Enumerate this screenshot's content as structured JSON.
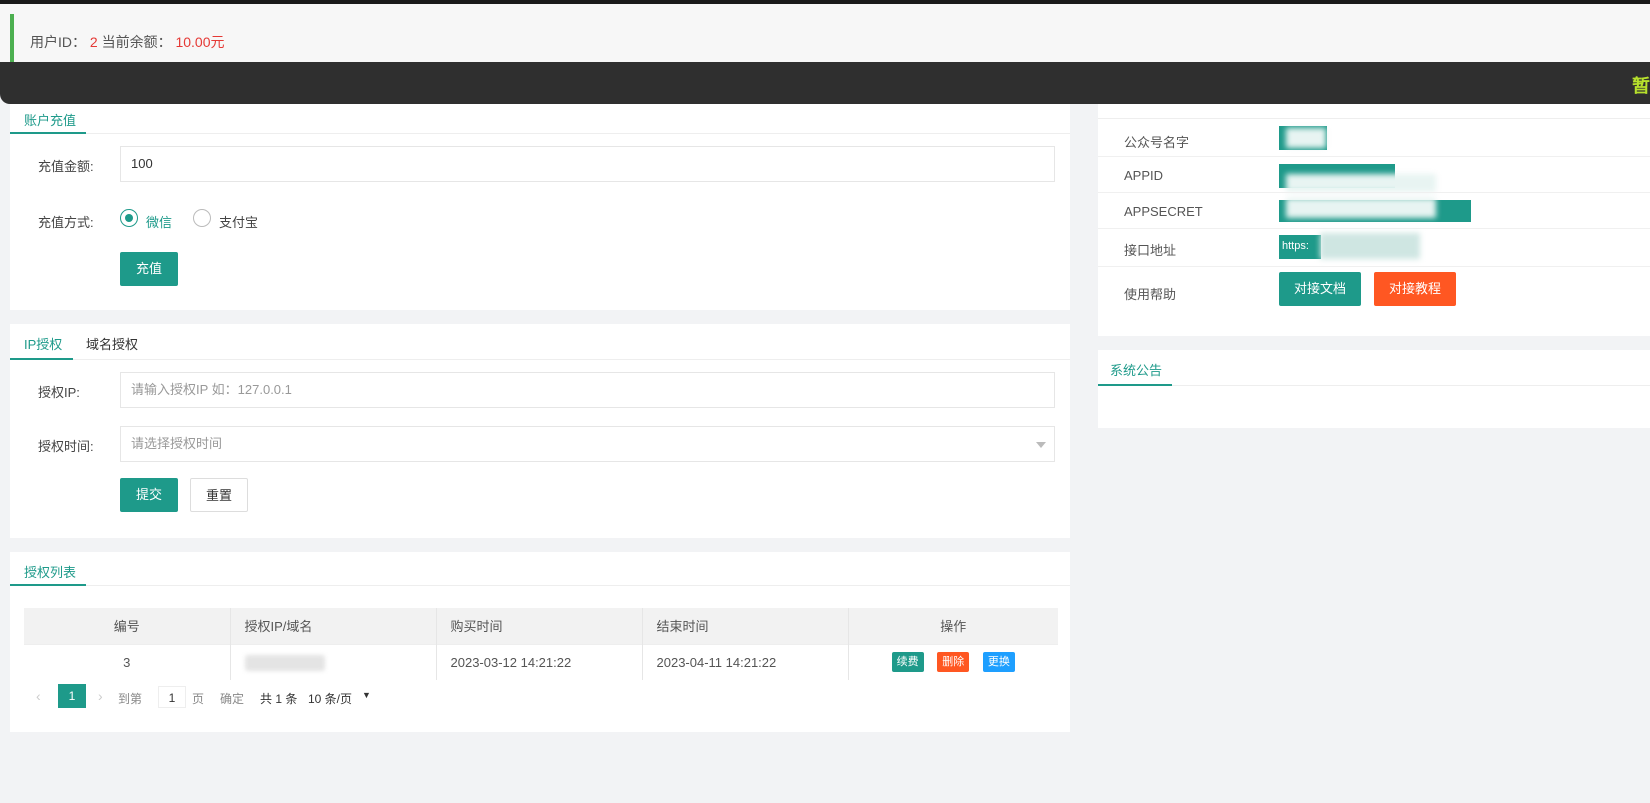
{
  "topbar": {
    "user_id_label": "用户ID：",
    "user_id": "2",
    "balance_label": "当前余额：",
    "balance": "10.00元",
    "notice_text": "暂"
  },
  "recharge": {
    "tab": "账户充值",
    "amount_label": "充值金额:",
    "amount_value": "100",
    "method_label": "充值方式:",
    "methods": [
      "微信",
      "支付宝"
    ],
    "selected_method": "微信",
    "submit": "充值"
  },
  "auth": {
    "tabs": [
      "IP授权",
      "域名授权"
    ],
    "active_tab": "IP授权",
    "ip_label": "授权IP:",
    "ip_placeholder": "请输入授权IP 如：127.0.0.1",
    "time_label": "授权时间:",
    "time_placeholder": "请选择授权时间",
    "submit": "提交",
    "reset": "重置"
  },
  "list": {
    "tab": "授权列表",
    "columns": [
      "编号",
      "授权IP/域名",
      "购买时间",
      "结束时间",
      "操作"
    ],
    "rows": [
      {
        "id": "3",
        "domain": "",
        "buy_time": "2023-03-12 14:21:22",
        "end_time": "2023-04-11 14:21:22",
        "actions": [
          "续费",
          "删除",
          "更换"
        ]
      }
    ],
    "pagination": {
      "current_page": "1",
      "goto_label": "到第",
      "goto_value": "1",
      "page_unit": "页",
      "confirm": "确定",
      "total": "共 1 条",
      "page_size": "10 条/页"
    }
  },
  "config": {
    "rows": [
      {
        "label": "公众号名字"
      },
      {
        "label": "APPID"
      },
      {
        "label": "APPSECRET"
      },
      {
        "label": "接口地址",
        "value_prefix": "https:"
      },
      {
        "label": "使用帮助"
      }
    ],
    "doc_button": "对接文档",
    "tutorial_button": "对接教程"
  },
  "announcement": {
    "tab": "系统公告"
  },
  "colors": {
    "accent": "#1e9a8a",
    "danger": "#ff5722",
    "info": "#1e9fff",
    "notice": "#b7e12c"
  }
}
